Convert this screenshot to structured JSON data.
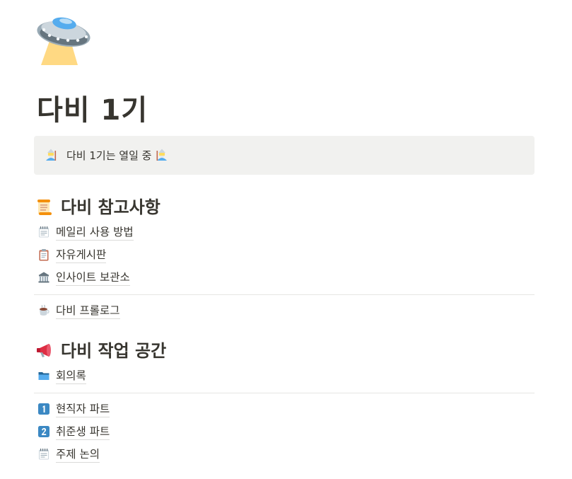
{
  "page": {
    "icon": "flying-saucer-icon",
    "title": "다비 1기"
  },
  "callout": {
    "icon": "mage-icon",
    "text": "다비 1기는 열일 중",
    "trailing_icon": "mage-icon"
  },
  "sections": [
    {
      "icon": "scroll-icon",
      "heading": "다비 참고사항",
      "links": [
        {
          "icon": "spiral-notepad-icon",
          "label": "메일리 사용 방법"
        },
        {
          "icon": "clipboard-icon",
          "label": "자유게시판"
        },
        {
          "icon": "classical-building-icon",
          "label": "인사이트 보관소"
        }
      ],
      "after_divider": [
        {
          "icon": "coffee-icon",
          "label": "다비 프롤로그"
        }
      ]
    },
    {
      "icon": "megaphone-icon",
      "heading": "다비 작업 공간",
      "links": [
        {
          "icon": "folder-icon",
          "label": "회의록"
        }
      ],
      "after_divider": [
        {
          "icon": "keycap-1-icon",
          "label": "현직자 파트"
        },
        {
          "icon": "keycap-2-icon",
          "label": "취준생 파트"
        },
        {
          "icon": "spiral-notepad-icon",
          "label": "주제 논의"
        }
      ]
    }
  ],
  "colors": {
    "text": "#37352f",
    "callout_bg": "#f1f1ef",
    "divider": "#e6e6e4"
  }
}
